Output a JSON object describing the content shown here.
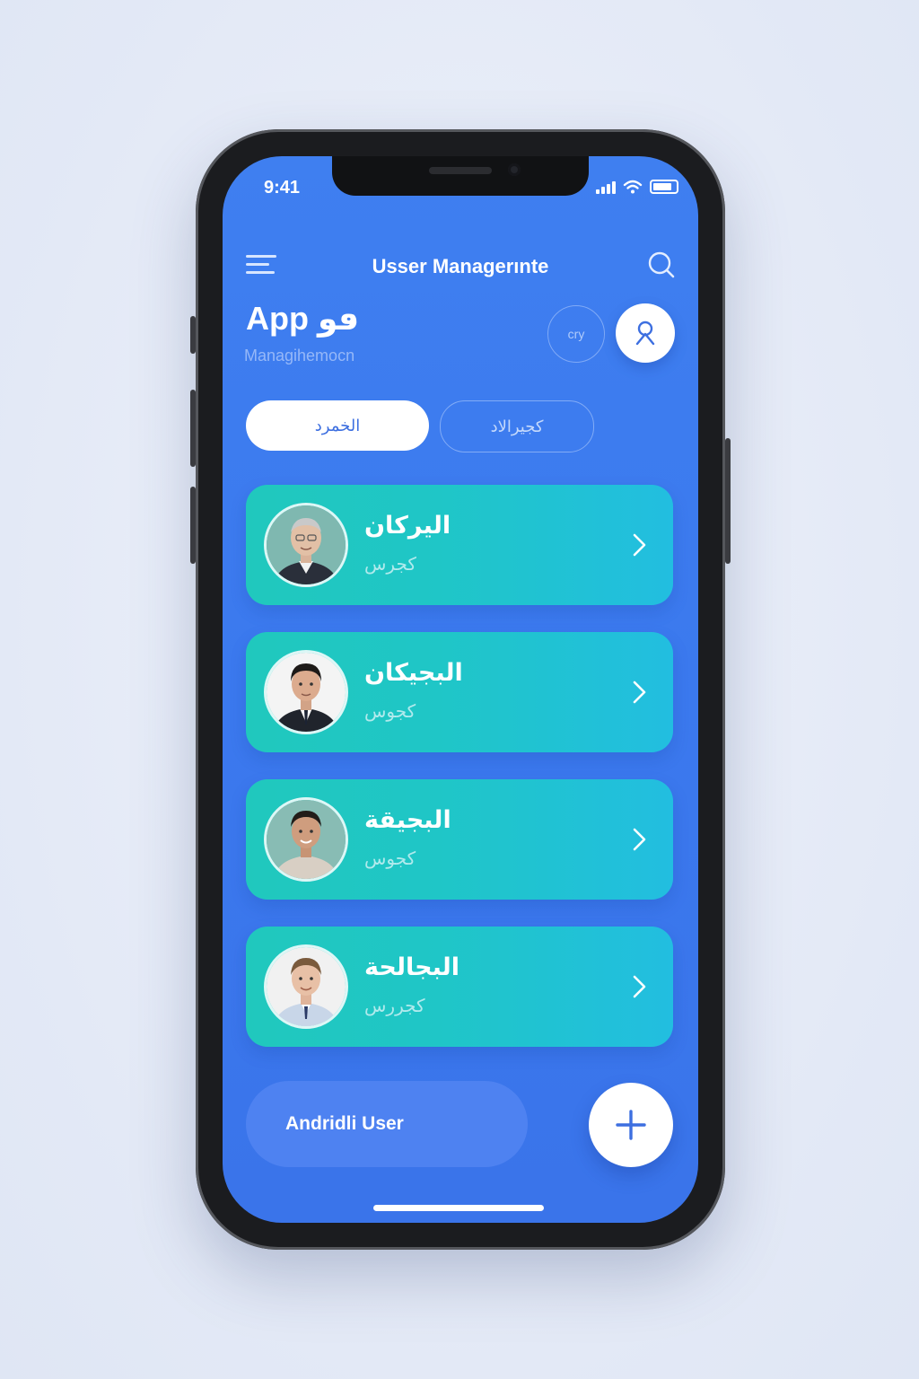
{
  "status_bar": {
    "time": "9:41"
  },
  "header": {
    "title": "Usser Managerınte",
    "menu_icon": "hamburger-menu-icon",
    "search_icon": "search-icon"
  },
  "hero": {
    "title": "App ڡو",
    "subtitle": "Managihemocn",
    "ghost_button_label": "cry",
    "profile_icon": "user-profile-icon"
  },
  "tabs": [
    {
      "label": "الخمرد",
      "active": true
    },
    {
      "label": "كجيرالاد",
      "active": false
    }
  ],
  "users": [
    {
      "name": "اليركان",
      "role": "كجرس",
      "chevron_icon": "chevron-right-icon"
    },
    {
      "name": "البجيكان",
      "role": "كجوس",
      "chevron_icon": "chevron-right-icon"
    },
    {
      "name": "البجيقة",
      "role": "كجوس",
      "chevron_icon": "chevron-right-icon"
    },
    {
      "name": "البجالحة",
      "role": "كجررس",
      "chevron_icon": "chevron-right-icon"
    }
  ],
  "bottom_bar": {
    "label": "Andridli User",
    "add_icon": "plus-icon"
  },
  "colors": {
    "screen_bg": "#3b79ee",
    "card_start": "#20c8bd",
    "card_end": "#22bee0",
    "tab_active_text": "#3d6fe0"
  }
}
